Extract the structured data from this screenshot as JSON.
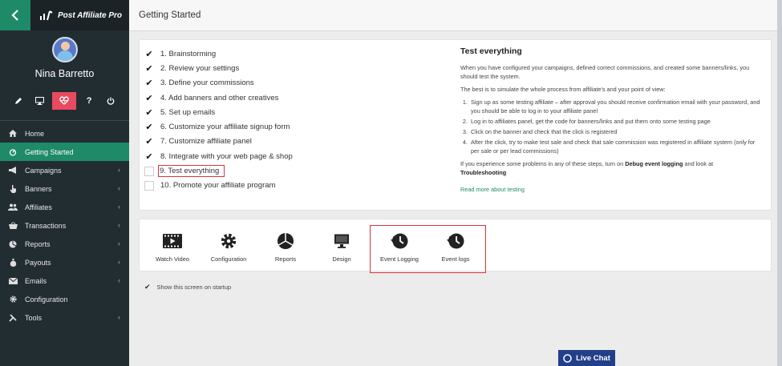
{
  "app": {
    "logo_text": "Post Affiliate Pro"
  },
  "user": {
    "name": "Nina Barretto"
  },
  "sidebar": {
    "quick_icons": [
      "pencil-icon",
      "monitor-icon",
      "heart-icon",
      "help-icon",
      "power-icon"
    ],
    "quick_help": "?",
    "items": [
      {
        "label": "Home",
        "icon": "home-icon",
        "expandable": false
      },
      {
        "label": "Getting Started",
        "icon": "rocket-icon",
        "expandable": false,
        "active": true
      },
      {
        "label": "Campaigns",
        "icon": "megaphone-icon",
        "expandable": true
      },
      {
        "label": "Banners",
        "icon": "pointer-icon",
        "expandable": true
      },
      {
        "label": "Affiliates",
        "icon": "users-icon",
        "expandable": true
      },
      {
        "label": "Transactions",
        "icon": "basket-icon",
        "expandable": true
      },
      {
        "label": "Reports",
        "icon": "pie-icon",
        "expandable": true
      },
      {
        "label": "Payouts",
        "icon": "moneybag-icon",
        "expandable": true
      },
      {
        "label": "Emails",
        "icon": "envelope-icon",
        "expandable": true
      },
      {
        "label": "Configuration",
        "icon": "gear-icon",
        "expandable": false
      },
      {
        "label": "Tools",
        "icon": "wrench-icon",
        "expandable": true
      }
    ]
  },
  "header": {
    "title": "Getting Started"
  },
  "steps": [
    {
      "label": "1. Brainstorming",
      "checked": true
    },
    {
      "label": "2. Review your settings",
      "checked": true
    },
    {
      "label": "3. Define your commissions",
      "checked": true
    },
    {
      "label": "4. Add banners and other creatives",
      "checked": true
    },
    {
      "label": "5. Set up emails",
      "checked": true
    },
    {
      "label": "6. Customize your affiliate signup form",
      "checked": true
    },
    {
      "label": "7. Customize affiliate panel",
      "checked": true
    },
    {
      "label": "8. Integrate with your web page & shop",
      "checked": true
    },
    {
      "label": "9. Test everything",
      "checked": false,
      "highlighted": true
    },
    {
      "label": "10. Promote your affiliate program",
      "checked": false
    }
  ],
  "detail": {
    "title": "Test everything",
    "intro": "When you have configured your campaigns, defined correct commissions, and created some banners/links, you should test the system.",
    "simulate": "The best is to simulate the whole process from affiliate's and your point of view:",
    "list": [
      "Sign up as some testing affiliate – after approval you should receive confirmation email with your password, and you should be able to log in to your affiliate panel",
      "Log in to affiliates panel, get the code for banners/links and put them onto some testing page",
      "Click on the banner and check that the click is registered",
      "After the click, try to make test sale and check that sale commission was registered in affiliate system (only for per sale or per lead commissions)"
    ],
    "problems_prefix": "If you experience some problems in any of these steps, turn on ",
    "problems_bold1": "Debug event logging",
    "problems_mid": " and look at ",
    "problems_bold2": "Troubleshooting",
    "read_more": "Read more about testing"
  },
  "tools": [
    {
      "label": "Watch Video",
      "icon": "film-icon"
    },
    {
      "label": "Configuration",
      "icon": "gear-icon"
    },
    {
      "label": "Reports",
      "icon": "pie-chart-icon"
    },
    {
      "label": "Design",
      "icon": "monitor-icon"
    },
    {
      "label": "Event Logging",
      "icon": "history-clock-icon"
    },
    {
      "label": "Event logs",
      "icon": "history-clock-icon"
    }
  ],
  "startup": {
    "label": "Show this screen on startup",
    "checked": true
  },
  "livechat": {
    "label": "Live Chat"
  },
  "colors": {
    "sidebar": "#222d32",
    "accent": "#1e8a68",
    "highlight": "#d9363e",
    "heart": "#e84a5f",
    "livechat": "#223f8a"
  }
}
